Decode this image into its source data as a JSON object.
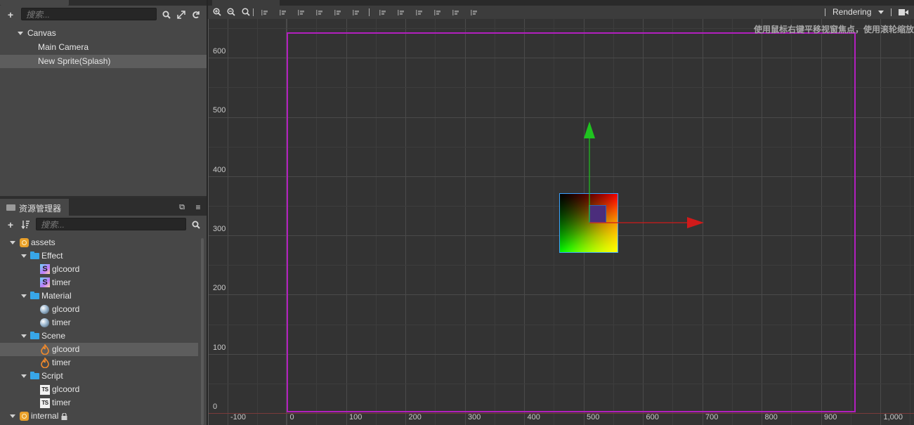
{
  "hierarchy": {
    "search_placeholder": "搜索...",
    "tree": [
      {
        "label": "Canvas",
        "expanded": true
      },
      {
        "label": "Main Camera"
      },
      {
        "label": "New Sprite(Splash)",
        "selected": true
      }
    ]
  },
  "assets": {
    "title": "资源管理器",
    "search_placeholder": "搜索...",
    "tree": [
      {
        "label": "assets",
        "kind": "db"
      },
      {
        "label": "Effect",
        "kind": "folder"
      },
      {
        "label": "glcoord",
        "kind": "effect",
        "glyph": "S"
      },
      {
        "label": "timer",
        "kind": "effect",
        "glyph": "S"
      },
      {
        "label": "Material",
        "kind": "folder"
      },
      {
        "label": "glcoord",
        "kind": "material"
      },
      {
        "label": "timer",
        "kind": "material"
      },
      {
        "label": "Scene",
        "kind": "folder"
      },
      {
        "label": "glcoord",
        "kind": "scene",
        "selected": true
      },
      {
        "label": "timer",
        "kind": "scene"
      },
      {
        "label": "Script",
        "kind": "folder"
      },
      {
        "label": "glcoord",
        "kind": "typescript",
        "glyph": "TS"
      },
      {
        "label": "timer",
        "kind": "typescript",
        "glyph": "TS"
      },
      {
        "label": "internal",
        "kind": "db",
        "locked": true
      }
    ]
  },
  "scene": {
    "rendering_label": "Rendering",
    "hint_text": "使用鼠标右键平移视窗焦点，使用滚轮缩放",
    "y_ticks": [
      "600",
      "500",
      "400",
      "300",
      "200",
      "100",
      "0"
    ],
    "x_ticks": [
      "-100",
      "0",
      "100",
      "200",
      "300",
      "400",
      "500",
      "600",
      "700",
      "800",
      "900",
      "1,000"
    ],
    "colors": {
      "canvas_border": "#b31fbf",
      "axis_x": "#d01a1a",
      "axis_y": "#1fc41f",
      "selection": "#3aa0ff"
    }
  }
}
